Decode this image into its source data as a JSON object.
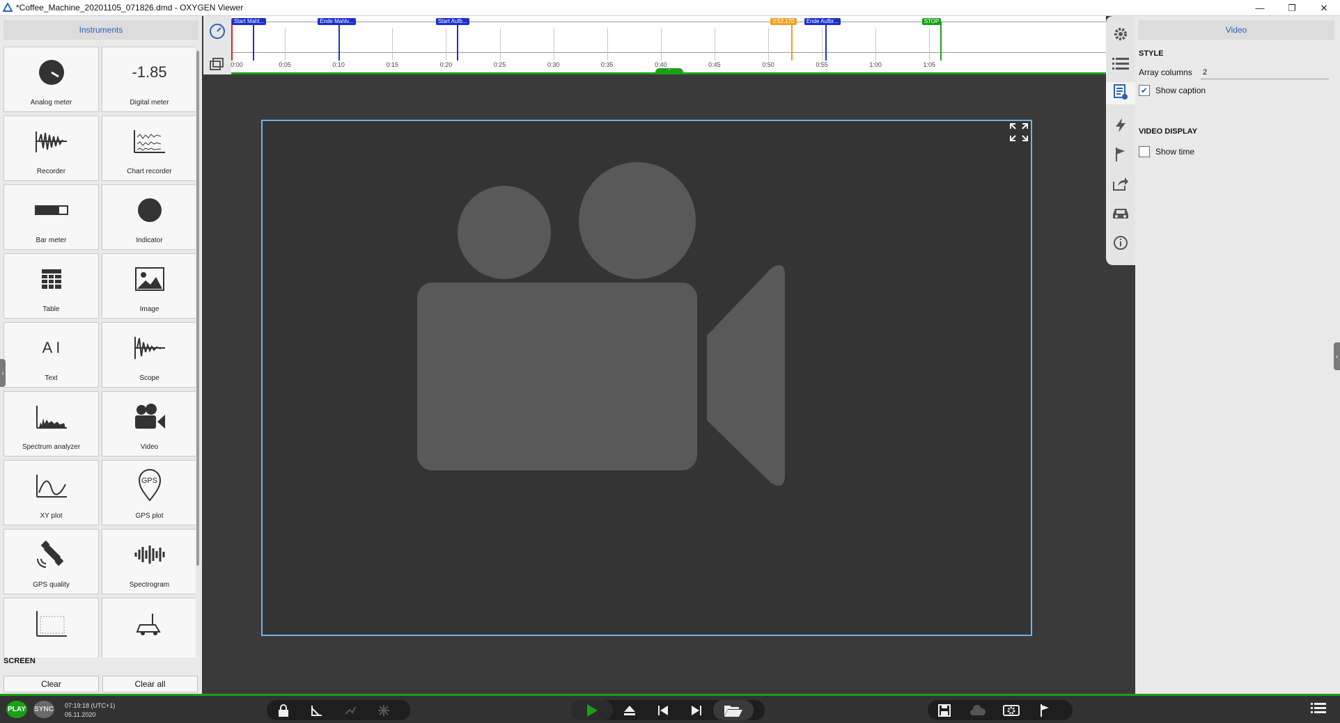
{
  "window": {
    "title": "*Coffee_Machine_20201105_071826.dmd - OXYGEN Viewer",
    "controls": [
      "minimize",
      "restore",
      "close"
    ]
  },
  "left_panel": {
    "title": "Instruments",
    "instruments": [
      {
        "label": "Analog meter",
        "icon": "analog-meter-icon"
      },
      {
        "label": "Digital meter",
        "icon": "digital-meter-icon",
        "value_text": "-1.85"
      },
      {
        "label": "Recorder",
        "icon": "recorder-icon"
      },
      {
        "label": "Chart recorder",
        "icon": "chart-recorder-icon"
      },
      {
        "label": "Bar meter",
        "icon": "bar-meter-icon"
      },
      {
        "label": "Indicator",
        "icon": "indicator-icon"
      },
      {
        "label": "Table",
        "icon": "table-icon"
      },
      {
        "label": "Image",
        "icon": "image-icon"
      },
      {
        "label": "Text",
        "icon": "text-icon",
        "glyph": "A I"
      },
      {
        "label": "Scope",
        "icon": "scope-icon"
      },
      {
        "label": "Spectrum analyzer",
        "icon": "spectrum-analyzer-icon"
      },
      {
        "label": "Video",
        "icon": "video-icon"
      },
      {
        "label": "XY plot",
        "icon": "xy-plot-icon"
      },
      {
        "label": "GPS plot",
        "icon": "gps-plot-icon",
        "glyph": "GPS"
      },
      {
        "label": "GPS quality",
        "icon": "gps-quality-icon"
      },
      {
        "label": "Spectrogram",
        "icon": "spectrogram-icon"
      },
      {
        "label": "",
        "icon": "heatmap-icon"
      },
      {
        "label": "",
        "icon": "vehicle-icon"
      }
    ],
    "screen": {
      "title": "SCREEN",
      "clear_label": "Clear",
      "clear_all_label": "Clear all"
    }
  },
  "timeline": {
    "ticks": [
      "0:00",
      "0:05",
      "0:10",
      "0:15",
      "0:20",
      "0:25",
      "0:30",
      "0:35",
      "0:40",
      "0:45",
      "0:50",
      "0:55",
      "1:00",
      "1:05"
    ],
    "markers": [
      {
        "label": "STA",
        "color": "#e02020",
        "time_s": 0
      },
      {
        "label": "Start Mahl...",
        "color": "#1a2fd0",
        "time_s": 2
      },
      {
        "label": "Ende Mahlv...",
        "color": "#1a2fd0",
        "time_s": 10
      },
      {
        "label": "Start Aufb...",
        "color": "#1a2fd0",
        "time_s": 21
      },
      {
        "label": "0:52.170",
        "color": "#f0a020",
        "time_s": 52.17
      },
      {
        "label": "Ende Aufbr...",
        "color": "#1a2fd0",
        "time_s": 55.3
      },
      {
        "label": "STOP",
        "color": "#19a019",
        "time_s": 66
      }
    ],
    "max_time_s": 66.5
  },
  "right_panel": {
    "title": "Video",
    "style_title": "STYLE",
    "array_columns_label": "Array columns",
    "array_columns_value": "2",
    "show_caption_label": "Show caption",
    "show_caption_checked": true,
    "video_display_title": "VIDEO DISPLAY",
    "show_time_label": "Show time",
    "show_time_checked": false
  },
  "status": {
    "play_label": "PLAY",
    "sync_label": "SYNC",
    "time": "07:19:18 (UTC+1)",
    "date": "05.11.2020"
  },
  "colors": {
    "accent": "#2a62b8",
    "play_green": "#19a019",
    "frame_border": "#74b2e8",
    "canvas_bg": "#3a3a3a"
  }
}
